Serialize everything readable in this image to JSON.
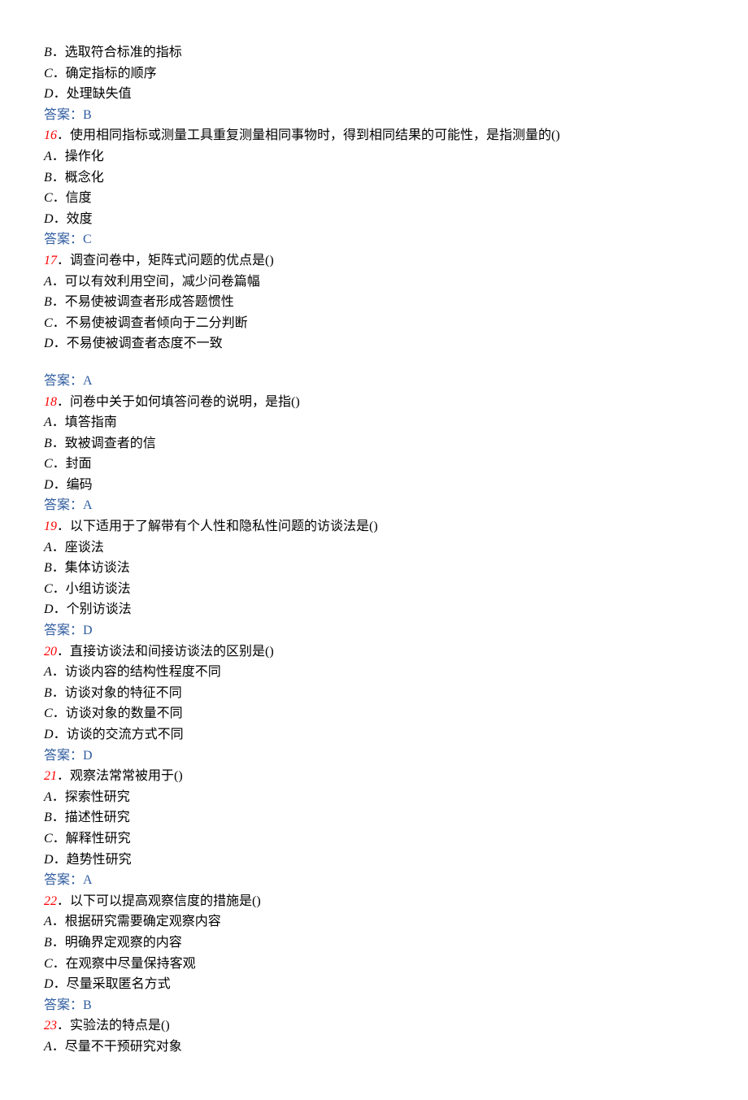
{
  "partialOptions": [
    {
      "letter": "B",
      "text": "．选取符合标准的指标"
    },
    {
      "letter": "C",
      "text": "．确定指标的顺序"
    },
    {
      "letter": "D",
      "text": "．处理缺失值"
    }
  ],
  "partialAnswer": {
    "label": "答案：",
    "value": "B"
  },
  "questions": [
    {
      "num": "16",
      "numSuffix": "．",
      "text": "使用相同指标或测量工具重复测量相同事物时，得到相同结果的可能性，是指测量的()",
      "options": [
        {
          "letter": "A",
          "text": "．操作化"
        },
        {
          "letter": "B",
          "text": "．概念化"
        },
        {
          "letter": "C",
          "text": "．信度"
        },
        {
          "letter": "D",
          "text": "．效度"
        }
      ],
      "answer": {
        "label": "答案：",
        "value": "C"
      },
      "gapAfterOptions": false
    },
    {
      "num": "17",
      "numSuffix": "．",
      "text": "调查问卷中，矩阵式问题的优点是()",
      "options": [
        {
          "letter": "A",
          "text": "．可以有效利用空间，减少问卷篇幅"
        },
        {
          "letter": "B",
          "text": "．不易使被调查者形成答题惯性"
        },
        {
          "letter": "C",
          "text": "．不易使被调查者倾向于二分判断"
        },
        {
          "letter": "D",
          "text": "．不易使被调查者态度不一致"
        }
      ],
      "answer": {
        "label": "答案：",
        "value": "A"
      },
      "gapAfterOptions": true
    },
    {
      "num": "18",
      "numSuffix": "．",
      "text": "问卷中关于如何填答问卷的说明，是指()",
      "options": [
        {
          "letter": "A",
          "text": "．填答指南"
        },
        {
          "letter": "B",
          "text": "．致被调查者的信"
        },
        {
          "letter": "C",
          "text": "．封面"
        },
        {
          "letter": "D",
          "text": "．编码"
        }
      ],
      "answer": {
        "label": "答案：",
        "value": "A"
      },
      "gapAfterOptions": false
    },
    {
      "num": "19",
      "numSuffix": "．",
      "text": "以下适用于了解带有个人性和隐私性问题的访谈法是()",
      "options": [
        {
          "letter": "A",
          "text": "．座谈法"
        },
        {
          "letter": "B",
          "text": "．集体访谈法"
        },
        {
          "letter": "C",
          "text": "．小组访谈法"
        },
        {
          "letter": "D",
          "text": "．个别访谈法"
        }
      ],
      "answer": {
        "label": "答案：",
        "value": "D"
      },
      "gapAfterOptions": false
    },
    {
      "num": "20",
      "numSuffix": "．",
      "text": "直接访谈法和间接访谈法的区别是()",
      "options": [
        {
          "letter": "A",
          "text": "．访谈内容的结构性程度不同"
        },
        {
          "letter": "B",
          "text": "．访谈对象的特征不同"
        },
        {
          "letter": "C",
          "text": "．访谈对象的数量不同"
        },
        {
          "letter": "D",
          "text": "．访谈的交流方式不同"
        }
      ],
      "answer": {
        "label": "答案：",
        "value": "D"
      },
      "gapAfterOptions": false
    },
    {
      "num": "21",
      "numSuffix": "．",
      "text": "观察法常常被用于()",
      "options": [
        {
          "letter": "A",
          "text": "．探索性研究"
        },
        {
          "letter": "B",
          "text": "．描述性研究"
        },
        {
          "letter": "C",
          "text": "．解释性研究"
        },
        {
          "letter": "D",
          "text": "．趋势性研究"
        }
      ],
      "answer": {
        "label": "答案：",
        "value": "A"
      },
      "gapAfterOptions": false
    },
    {
      "num": "22",
      "numSuffix": "．",
      "text": "以下可以提高观察信度的措施是()",
      "options": [
        {
          "letter": "A",
          "text": "．根据研究需要确定观察内容"
        },
        {
          "letter": "B",
          "text": "．明确界定观察的内容"
        },
        {
          "letter": "C",
          "text": "．在观察中尽量保持客观"
        },
        {
          "letter": "D",
          "text": "．尽量采取匿名方式"
        }
      ],
      "answer": {
        "label": "答案：",
        "value": "B"
      },
      "gapAfterOptions": false
    },
    {
      "num": "23",
      "numSuffix": "．",
      "text": "实验法的特点是()",
      "options": [
        {
          "letter": "A",
          "text": "．尽量不干预研究对象"
        }
      ],
      "answer": null,
      "gapAfterOptions": false
    }
  ]
}
